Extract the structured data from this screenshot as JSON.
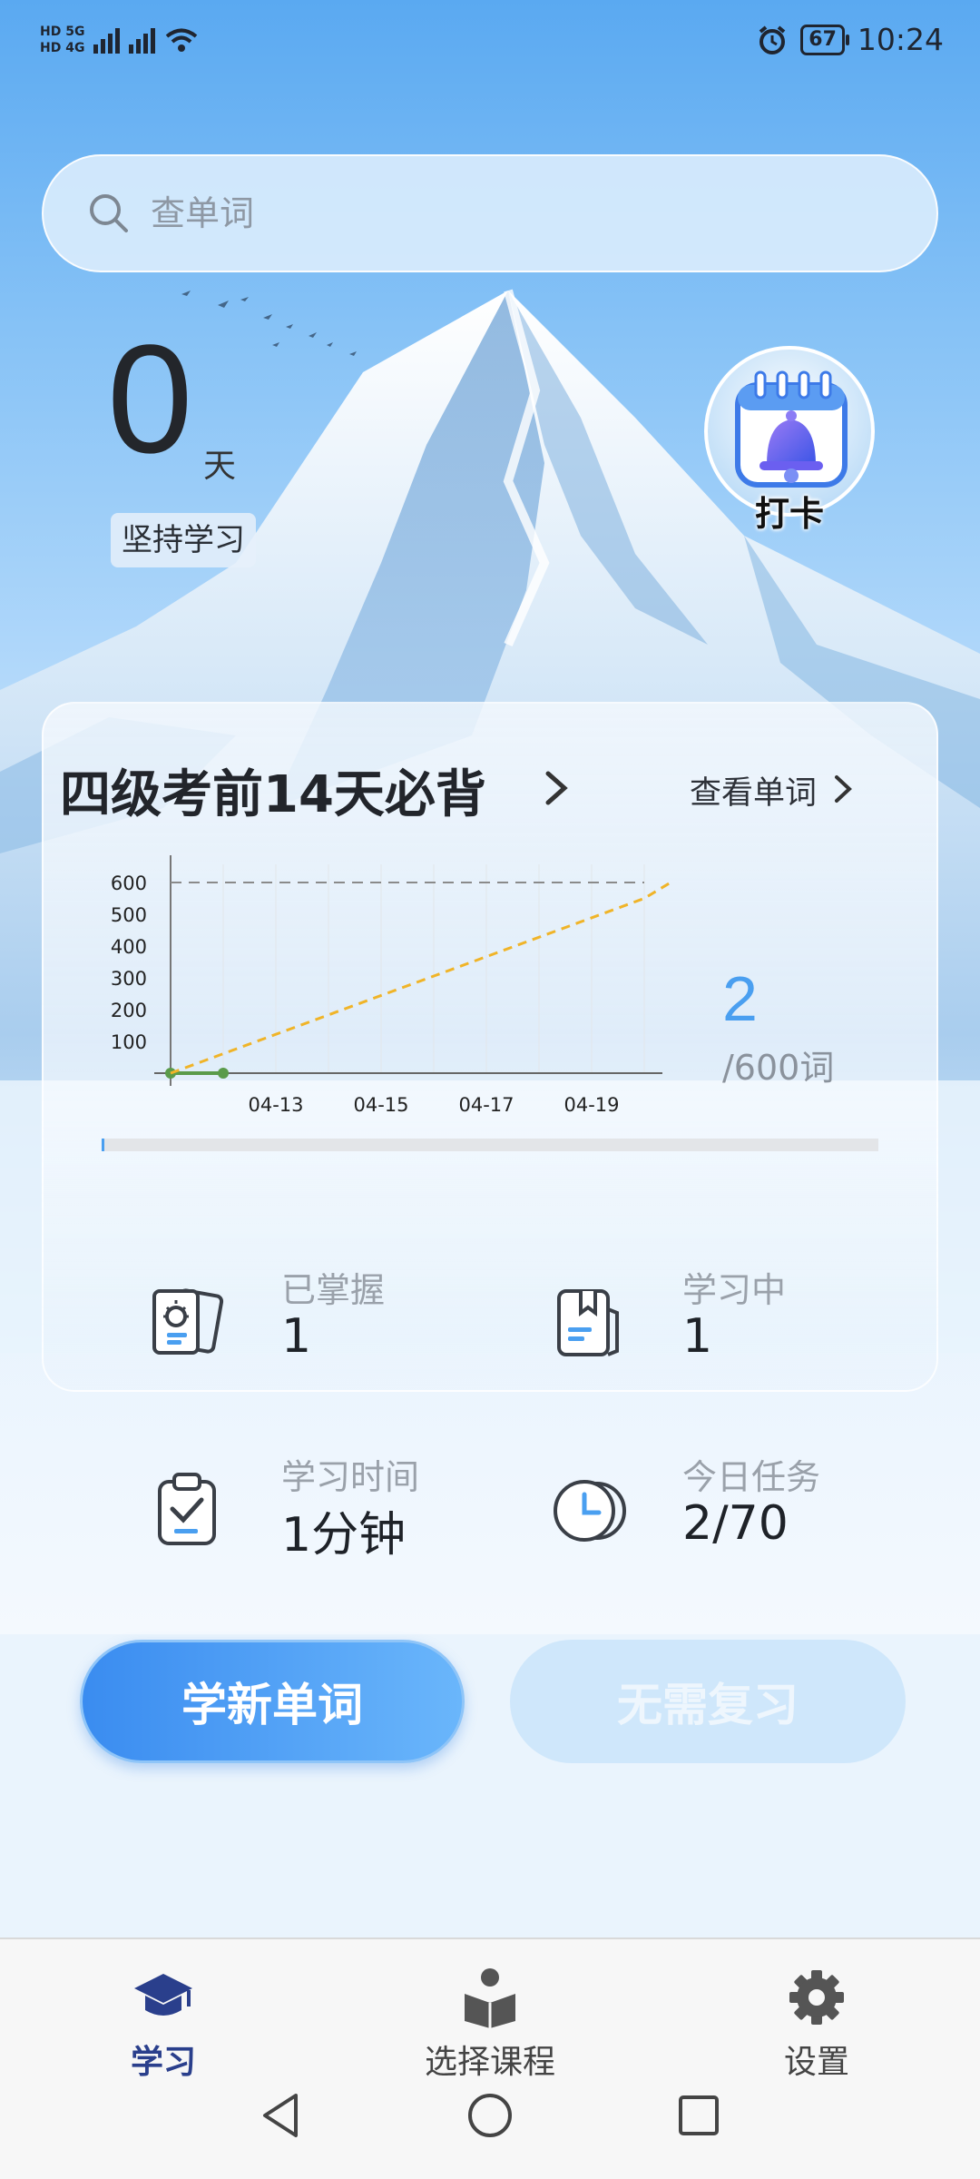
{
  "status_bar": {
    "network_top": "HD 5G",
    "network_bottom": "HD 4G",
    "battery": "67",
    "time": "10:24",
    "icons": [
      "signal-icon",
      "wifi-icon",
      "alarm-icon",
      "battery-icon"
    ]
  },
  "search": {
    "placeholder": "查单词"
  },
  "streak": {
    "days": "0",
    "unit": "天",
    "label": "坚持学习"
  },
  "checkin": {
    "label": "打卡",
    "icon": "calendar-bell-icon"
  },
  "course": {
    "title": "四级考前14天必背",
    "view_words": "查看单词",
    "learned": "2",
    "total": "/600词",
    "progress": 0.0033
  },
  "chart_data": {
    "type": "line",
    "y_ticks": [
      "600",
      "500",
      "400",
      "300",
      "200",
      "100"
    ],
    "x_ticks": [
      "04-13",
      "04-15",
      "04-17",
      "04-19"
    ],
    "ylim": [
      0,
      600
    ],
    "target_line": 600,
    "series": [
      {
        "values": [
          [
            0,
            0
          ],
          [
            1,
            0
          ]
        ],
        "style": "solid",
        "color": "#5a9b4a"
      },
      {
        "values": [
          [
            0,
            0
          ],
          [
            9,
            550
          ],
          [
            9.5,
            600
          ]
        ],
        "style": "dashed",
        "color": "#f0b428"
      }
    ],
    "grid": true
  },
  "stats": [
    {
      "label": "已掌握",
      "value": "1",
      "icon": "lightbulb-cards-icon"
    },
    {
      "label": "学习中",
      "value": "1",
      "icon": "book-notes-icon"
    },
    {
      "label": "学习时间",
      "value": "1分钟",
      "icon": "clipboard-check-icon"
    },
    {
      "label": "今日任务",
      "value": "2/70",
      "icon": "clock-icon"
    }
  ],
  "actions": {
    "learn_new": "学新单词",
    "no_review": "无需复习"
  },
  "nav": [
    {
      "label": "学习",
      "icon": "graduation-cap-icon",
      "active": true
    },
    {
      "label": "选择课程",
      "icon": "reader-book-icon",
      "active": false
    },
    {
      "label": "设置",
      "icon": "gear-icon",
      "active": false
    }
  ],
  "colors": {
    "accent": "#4a9ff0",
    "nav_active": "#2a3f8c",
    "target_line": "#f0b428",
    "actual_line": "#5a9b4a"
  }
}
